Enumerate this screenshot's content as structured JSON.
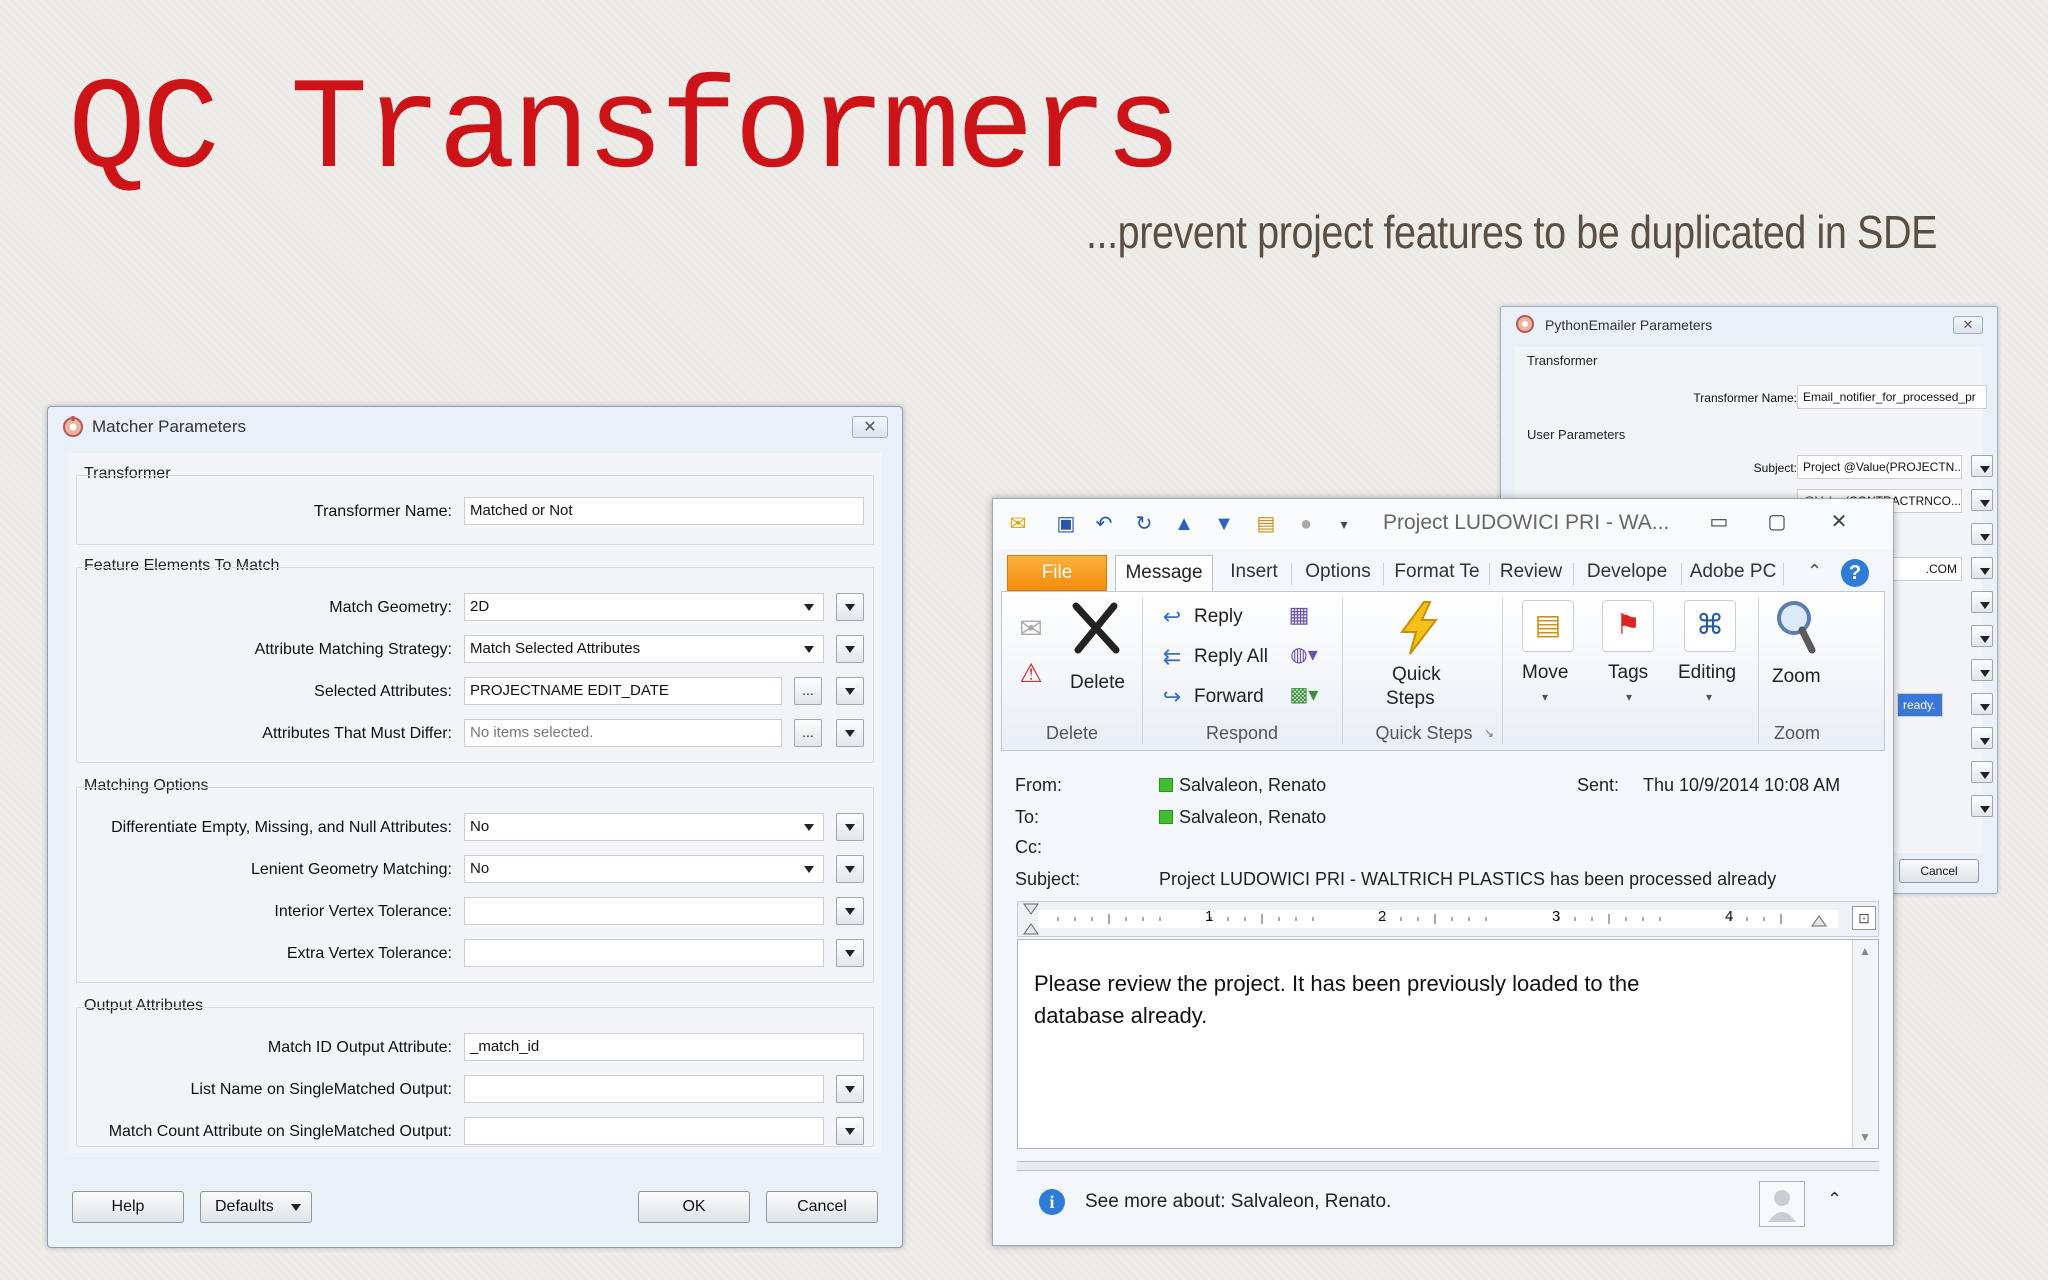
{
  "slide": {
    "title": "QC Transformers",
    "subtitle": "...prevent project features to be duplicated in SDE"
  },
  "matcher": {
    "window_title": "Matcher Parameters",
    "close_label": "✕",
    "transformer_group": "Transformer",
    "transformer_name_label": "Transformer Name:",
    "transformer_name_value": "Matched or Not",
    "feature_group": "Feature Elements To Match",
    "match_geometry_label": "Match Geometry:",
    "match_geometry_value": "2D",
    "attr_strategy_label": "Attribute Matching Strategy:",
    "attr_strategy_value": "Match Selected Attributes",
    "selected_attrs_label": "Selected Attributes:",
    "selected_attrs_value": "PROJECTNAME EDIT_DATE",
    "attrs_differ_label": "Attributes That Must Differ:",
    "attrs_differ_placeholder": "No items selected.",
    "ellipsis": "...",
    "matching_group": "Matching Options",
    "diff_empty_label": "Differentiate Empty, Missing, and Null Attributes:",
    "diff_empty_value": "No",
    "lenient_label": "Lenient Geometry Matching:",
    "lenient_value": "No",
    "interior_tol_label": "Interior Vertex Tolerance:",
    "interior_tol_value": "",
    "extra_tol_label": "Extra Vertex Tolerance:",
    "extra_tol_value": "",
    "output_group": "Output Attributes",
    "match_id_label": "Match ID Output Attribute:",
    "match_id_value": "_match_id",
    "list_name_label": "List Name on SingleMatched Output:",
    "list_name_value": "",
    "match_count_label": "Match Count Attribute on SingleMatched Output:",
    "match_count_value": "",
    "help_label": "Help",
    "defaults_label": "Defaults",
    "ok_label": "OK",
    "cancel_label": "Cancel"
  },
  "pyemailer": {
    "window_title": "PythonEmailer Parameters",
    "transformer_group": "Transformer",
    "transformer_name_label": "Transformer Name:",
    "transformer_name_value": "Email_notifier_for_processed_pr",
    "user_group": "User Parameters",
    "subject_label": "Subject:",
    "subject_value": "Project @Value(PROJECTN...",
    "row2_value": "@Value(CONTRACTRNCO...",
    "row3_value": ".COM",
    "row4_value": "ready.",
    "cancel_label": "Cancel"
  },
  "outlook": {
    "window_title": "Project LUDOWICI PRI - WA...",
    "tabs": [
      "File",
      "Message",
      "Insert",
      "Options",
      "Format Te",
      "Review",
      "Develope",
      "Adobe PC"
    ],
    "delete_btn": "Delete",
    "delete_group": "Delete",
    "reply_btn": "Reply",
    "reply_all_btn": "Reply All",
    "forward_btn": "Forward",
    "respond_group": "Respond",
    "quick_steps_btn_line1": "Quick",
    "quick_steps_btn_line2": "Steps",
    "quick_steps_group": "Quick Steps",
    "move_btn": "Move",
    "tags_btn": "Tags",
    "editing_btn": "Editing",
    "zoom_btn": "Zoom",
    "zoom_group": "Zoom",
    "from_label": "From:",
    "from_value": "Salvaleon, Renato",
    "to_label": "To:",
    "to_value": "Salvaleon, Renato",
    "cc_label": "Cc:",
    "subject_label": "Subject:",
    "subject_value": "Project LUDOWICI PRI - WALTRICH PLASTICS  has been processed already",
    "sent_label": "Sent:",
    "sent_value": "Thu 10/9/2014 10:08 AM",
    "ruler_marks": [
      "1",
      "2",
      "3",
      "4"
    ],
    "body_text": "Please review the project. It has been previously loaded to the database already.",
    "people_text": "See more about: Salvaleon, Renato."
  }
}
